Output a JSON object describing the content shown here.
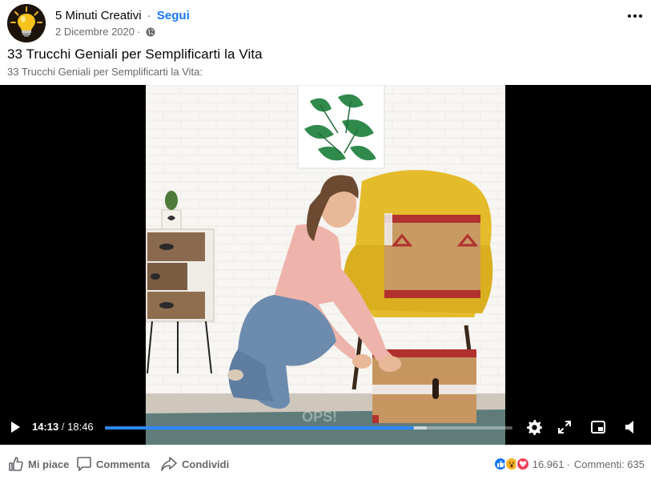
{
  "header": {
    "page_name": "5 Minuti Creativi",
    "separator": "·",
    "follow_label": "Segui",
    "date": "2 Dicembre 2020",
    "date_separator": "·"
  },
  "post": {
    "title": "33 Trucchi Geniali per Semplificarti la Vita",
    "description": "33 Trucchi Geniali per Semplificarti la Vita:"
  },
  "video": {
    "current_time": "14:13",
    "time_separator": "/",
    "duration": "18:46",
    "progress_fraction": 0.758,
    "buffered_fraction": 0.79,
    "watermark": "OPS!",
    "accent_color": "#2d88ff"
  },
  "actions": {
    "like_label": "Mi piace",
    "comment_label": "Commenta",
    "share_label": "Condividi"
  },
  "stats": {
    "reaction_count": "16.961",
    "separator": "·",
    "comments": "Commenti: 635",
    "reaction_icons": [
      "like-icon",
      "wow-icon",
      "love-icon"
    ]
  },
  "icons": {
    "avatar": "lightbulb-logo",
    "privacy": "globe-icon",
    "more": "more-options-icon",
    "play": "play-icon",
    "settings": "gear-icon",
    "fullscreen": "expand-icon",
    "pip": "picture-in-picture-icon",
    "volume": "volume-icon"
  }
}
